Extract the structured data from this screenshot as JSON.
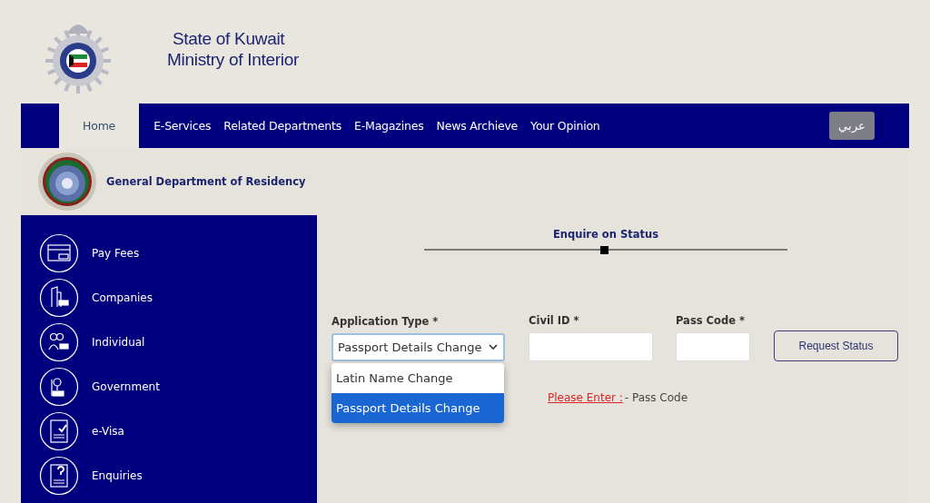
{
  "header": {
    "title_lines": [
      "State of Kuwait",
      "Ministry of Interior"
    ]
  },
  "nav": {
    "items": [
      {
        "label": "Home",
        "selected": true
      },
      {
        "label": "E-Services",
        "selected": false
      },
      {
        "label": "Related Departments",
        "selected": false
      },
      {
        "label": "E-Magazines",
        "selected": false
      },
      {
        "label": "News Archieve",
        "selected": false
      },
      {
        "label": "Your Opinion",
        "selected": false
      }
    ],
    "language_button": "عربي"
  },
  "department": {
    "name": "General Department of Residency"
  },
  "sidebar": {
    "items": [
      {
        "label": "Pay Fees"
      },
      {
        "label": "Companies"
      },
      {
        "label": "Individual"
      },
      {
        "label": "Government"
      },
      {
        "label": "e-Visa"
      },
      {
        "label": "Enquiries"
      }
    ]
  },
  "form": {
    "title": "Enquire on Status",
    "fields": [
      {
        "kind": "select",
        "label": "Application Type *",
        "value": "Passport Details Change",
        "expanded": true,
        "options": [
          {
            "label": "Latin Name Change",
            "selected": false
          },
          {
            "label": "Passport Details Change",
            "selected": true
          }
        ]
      },
      {
        "kind": "text",
        "label": "Civil ID *"
      },
      {
        "kind": "text",
        "label": "Pass Code *"
      }
    ],
    "button": "Request Status",
    "message": {
      "prompt": "Please Enter : ",
      "text": "- Pass Code"
    }
  }
}
